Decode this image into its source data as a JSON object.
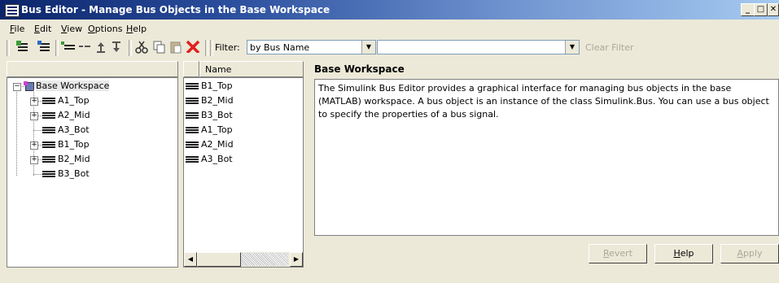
{
  "window": {
    "title": "Bus Editor - Manage Bus Objects in the Base Workspace",
    "controls": [
      "_",
      "□",
      "✕"
    ]
  },
  "menu": [
    {
      "label": "File",
      "mnemonic": "F",
      "rest": "ile"
    },
    {
      "label": "Edit",
      "mnemonic": "E",
      "rest": "dit"
    },
    {
      "label": "View",
      "mnemonic": "V",
      "rest": "iew"
    },
    {
      "label": "Options",
      "mnemonic": "O",
      "rest": "ptions"
    },
    {
      "label": "Help",
      "mnemonic": "H",
      "rest": "elp"
    }
  ],
  "toolbar": {
    "icons": [
      "add-bus-icon",
      "add-bus-element-icon",
      "insert-bus-element-icon",
      "remove-element-icon",
      "move-up-icon",
      "move-down-icon",
      "cut-icon",
      "copy-icon",
      "paste-icon",
      "delete-icon"
    ],
    "filter_label": "Filter:",
    "filter_by": "by Bus Name",
    "filter_text": "",
    "clear_filter": "Clear Filter",
    "delete_color": "#e02020"
  },
  "tree": {
    "root": "Base Workspace",
    "nodes": [
      {
        "label": "A1_Top",
        "expandable": true
      },
      {
        "label": "A2_Mid",
        "expandable": true
      },
      {
        "label": "A3_Bot",
        "expandable": false
      },
      {
        "label": "B1_Top",
        "expandable": true
      },
      {
        "label": "B2_Mid",
        "expandable": true
      },
      {
        "label": "B3_Bot",
        "expandable": false
      }
    ]
  },
  "list": {
    "header": "Name",
    "items": [
      "B1_Top",
      "B2_Mid",
      "B3_Bot",
      "A1_Top",
      "A2_Mid",
      "A3_Bot"
    ]
  },
  "detail": {
    "title": "Base Workspace",
    "description": "The Simulink Bus Editor provides a graphical interface for managing bus objects in the base (MATLAB) workspace. A bus object is an instance of the class Simulink.Bus. You can use a bus object to specify the properties of a bus signal."
  },
  "buttons": {
    "revert": {
      "mnemonic": "R",
      "rest": "evert"
    },
    "help": {
      "mnemonic": "H",
      "rest": "elp"
    },
    "apply": {
      "mnemonic": "A",
      "rest": "pply"
    }
  }
}
